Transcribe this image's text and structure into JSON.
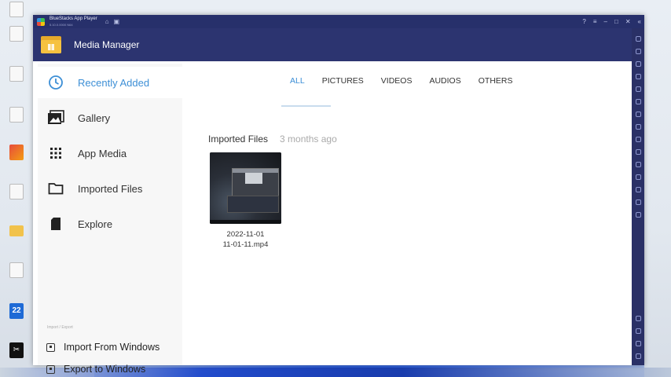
{
  "window": {
    "title": "BlueStacks App Player",
    "subtitle": "5.10.0.0000 N64"
  },
  "app": {
    "title": "Media Manager"
  },
  "nav": {
    "items": [
      {
        "label": "Recently Added",
        "icon": "clock-icon",
        "active": true
      },
      {
        "label": "Gallery",
        "icon": "gallery-icon",
        "active": false
      },
      {
        "label": "App Media",
        "icon": "grid-icon",
        "active": false
      },
      {
        "label": "Imported Files",
        "icon": "folder-icon",
        "active": false
      },
      {
        "label": "Explore",
        "icon": "sd-card-icon",
        "active": false
      }
    ],
    "section_label": "Import / Export",
    "import_label": "Import From Windows",
    "export_label": "Export to Windows"
  },
  "tabs": [
    "ALL",
    "PICTURES",
    "VIDEOS",
    "AUDIOS",
    "OTHERS"
  ],
  "active_tab": "ALL",
  "section": {
    "title": "Imported Files",
    "time": "3 months ago"
  },
  "files": [
    {
      "line1": "2022-11-01",
      "line2": "11-01-11.mp4"
    }
  ],
  "colors": {
    "accent": "#3d8fd6",
    "header": "#2c3470",
    "titlebar": "#27306b"
  }
}
